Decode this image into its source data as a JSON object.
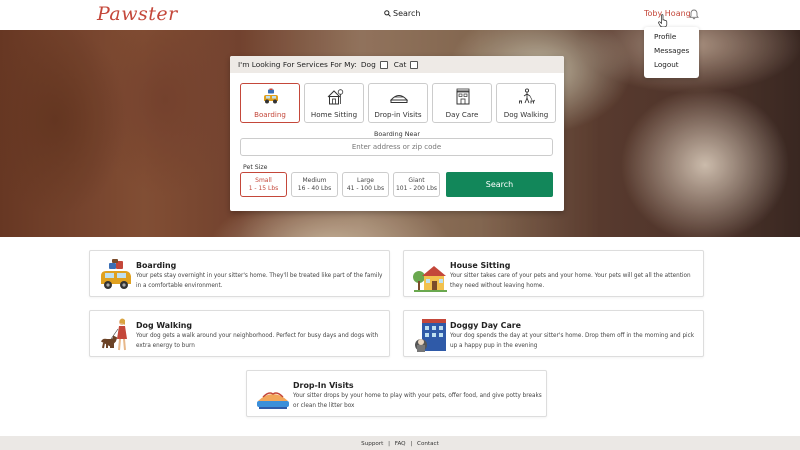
{
  "nav": {
    "logo": "Pawster",
    "search_label": "Search",
    "user_name": "Toby Hoang",
    "bell_icon": "bell-icon",
    "brand_color": "#c4473a"
  },
  "dropdown": {
    "items": [
      "Profile",
      "Messages",
      "Logout"
    ]
  },
  "search_panel": {
    "looking_for": "I'm Looking For Services For My:",
    "pet_dog": "Dog",
    "pet_cat": "Cat",
    "services": [
      {
        "label": "Boarding",
        "icon": "car-icon",
        "selected": true
      },
      {
        "label": "Home Sitting",
        "icon": "house-icon",
        "selected": false
      },
      {
        "label": "Drop-in Visits",
        "icon": "pet-bed-icon",
        "selected": false
      },
      {
        "label": "Day Care",
        "icon": "day-care-icon",
        "selected": false
      },
      {
        "label": "Dog Walking",
        "icon": "dog-walker-icon",
        "selected": false
      }
    ],
    "near_label": "Boarding Near",
    "near_placeholder": "Enter address or zip code",
    "pet_size_label": "Pet Size",
    "sizes": [
      {
        "name": "Small",
        "range": "1 - 15 Lbs",
        "selected": true
      },
      {
        "name": "Medium",
        "range": "16 - 40 Lbs",
        "selected": false
      },
      {
        "name": "Large",
        "range": "41 - 100 Lbs",
        "selected": false
      },
      {
        "name": "Giant",
        "range": "101 - 200 Lbs",
        "selected": false
      }
    ],
    "search_button": "Search",
    "search_button_color": "#12875a"
  },
  "cards": [
    {
      "title": "Boarding",
      "desc": "Your pets stay overnight in your sitter's home. They'll be treated like part of the family in a comfortable environment.",
      "icon": "car-luggage-icon"
    },
    {
      "title": "House Sitting",
      "desc": "Your sitter takes care of your pets and your home. Your pets will get all the attention they need without leaving home.",
      "icon": "house-tree-icon"
    },
    {
      "title": "Dog Walking",
      "desc": "Your dog gets a walk around your neighborhood. Perfect for busy days and dogs with extra energy to burn",
      "icon": "dog-walker-icon"
    },
    {
      "title": "Doggy Day Care",
      "desc": "Your dog spends the day at your sitter's home. Drop them off in the morning and pick up a happy pup in the evening",
      "icon": "daycare-building-icon"
    },
    {
      "title": "Drop-In Visits",
      "desc": "Your sitter drops by your home to play with your pets, offer food, and give potty breaks or clean the litter box",
      "icon": "pet-bed-icon"
    }
  ],
  "footer": {
    "links": [
      "Support",
      "FAQ",
      "Contact"
    ],
    "separator": "|"
  }
}
